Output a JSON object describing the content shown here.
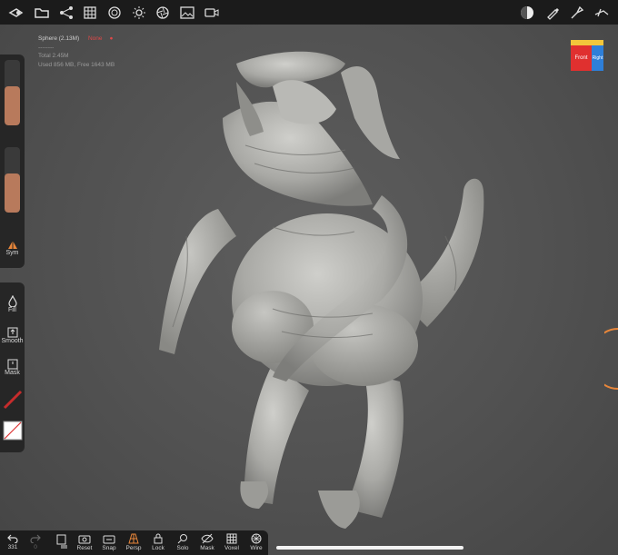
{
  "stats": {
    "mesh_name": "Sphere (2.13M)",
    "mesh_status": "None",
    "separator": "--------",
    "total": "Total 2.45M",
    "memory": "Used 856 MB,  Free 1643 MB"
  },
  "gizmo": {
    "front_label": "Front",
    "right_label": "Right"
  },
  "left_tools": {
    "sym_label": "Sym",
    "fill_label": "Fill",
    "smooth_label": "Smooth",
    "mask_label": "Mask",
    "radius_level": 0.6,
    "intensity_level": 0.6
  },
  "bottom": {
    "undo_count": "331",
    "redo_count": "0",
    "reset_label": "Reset",
    "snap_label": "Snap",
    "persp_label": "Persp",
    "lock_label": "Lock",
    "solo_label": "Solo",
    "mask_label": "Mask",
    "voxel_label": "Voxel",
    "wire_label": "Wire"
  },
  "colors": {
    "accent": "#e8863a",
    "slider_fill": "#b87a5c",
    "status_red": "#e04848"
  }
}
